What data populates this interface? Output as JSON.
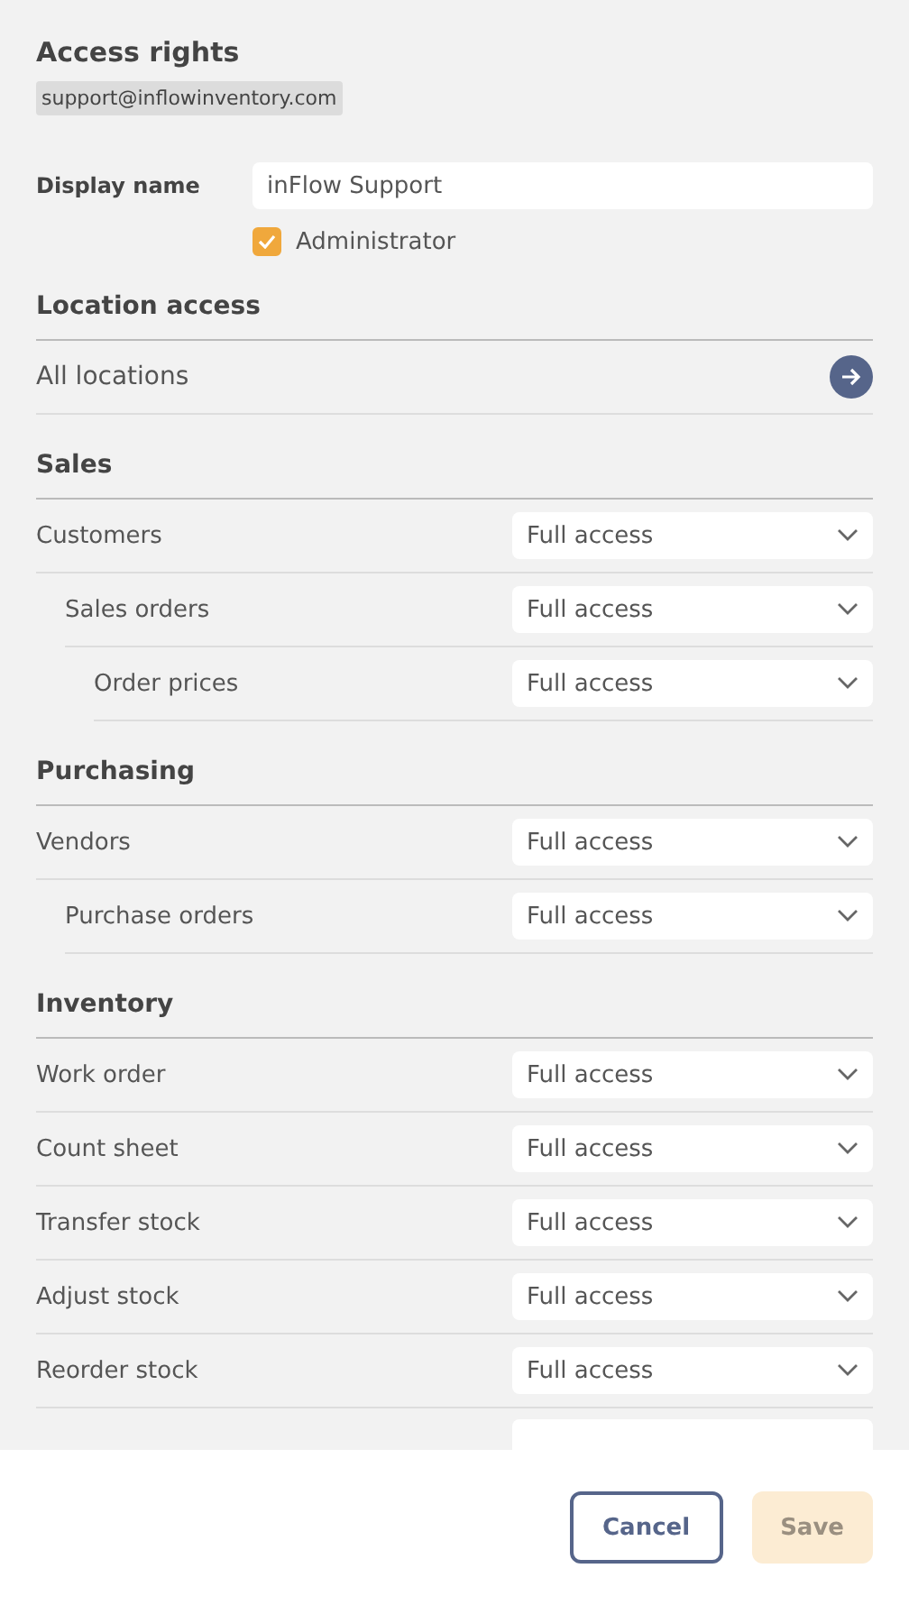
{
  "header": {
    "title": "Access rights",
    "email": "support@inflowinventory.com"
  },
  "display_name": {
    "label": "Display name",
    "value": "inFlow Support"
  },
  "administrator": {
    "label": "Administrator",
    "checked": true
  },
  "location_access": {
    "title": "Location access",
    "value": "All locations"
  },
  "sections": [
    {
      "title": "Sales",
      "rows": [
        {
          "label": "Customers",
          "value": "Full access",
          "children": [
            {
              "label": "Sales orders",
              "value": "Full access",
              "children": [
                {
                  "label": "Order prices",
                  "value": "Full access"
                }
              ]
            }
          ]
        }
      ]
    },
    {
      "title": "Purchasing",
      "rows": [
        {
          "label": "Vendors",
          "value": "Full access",
          "children": [
            {
              "label": "Purchase orders",
              "value": "Full access"
            }
          ]
        }
      ]
    },
    {
      "title": "Inventory",
      "rows": [
        {
          "label": "Work order",
          "value": "Full access"
        },
        {
          "label": "Count sheet",
          "value": "Full access"
        },
        {
          "label": "Transfer stock",
          "value": "Full access"
        },
        {
          "label": "Adjust stock",
          "value": "Full access"
        },
        {
          "label": "Reorder stock",
          "value": "Full access"
        }
      ]
    }
  ],
  "footer": {
    "cancel": "Cancel",
    "save": {
      "label": "Save",
      "disabled": true
    }
  }
}
